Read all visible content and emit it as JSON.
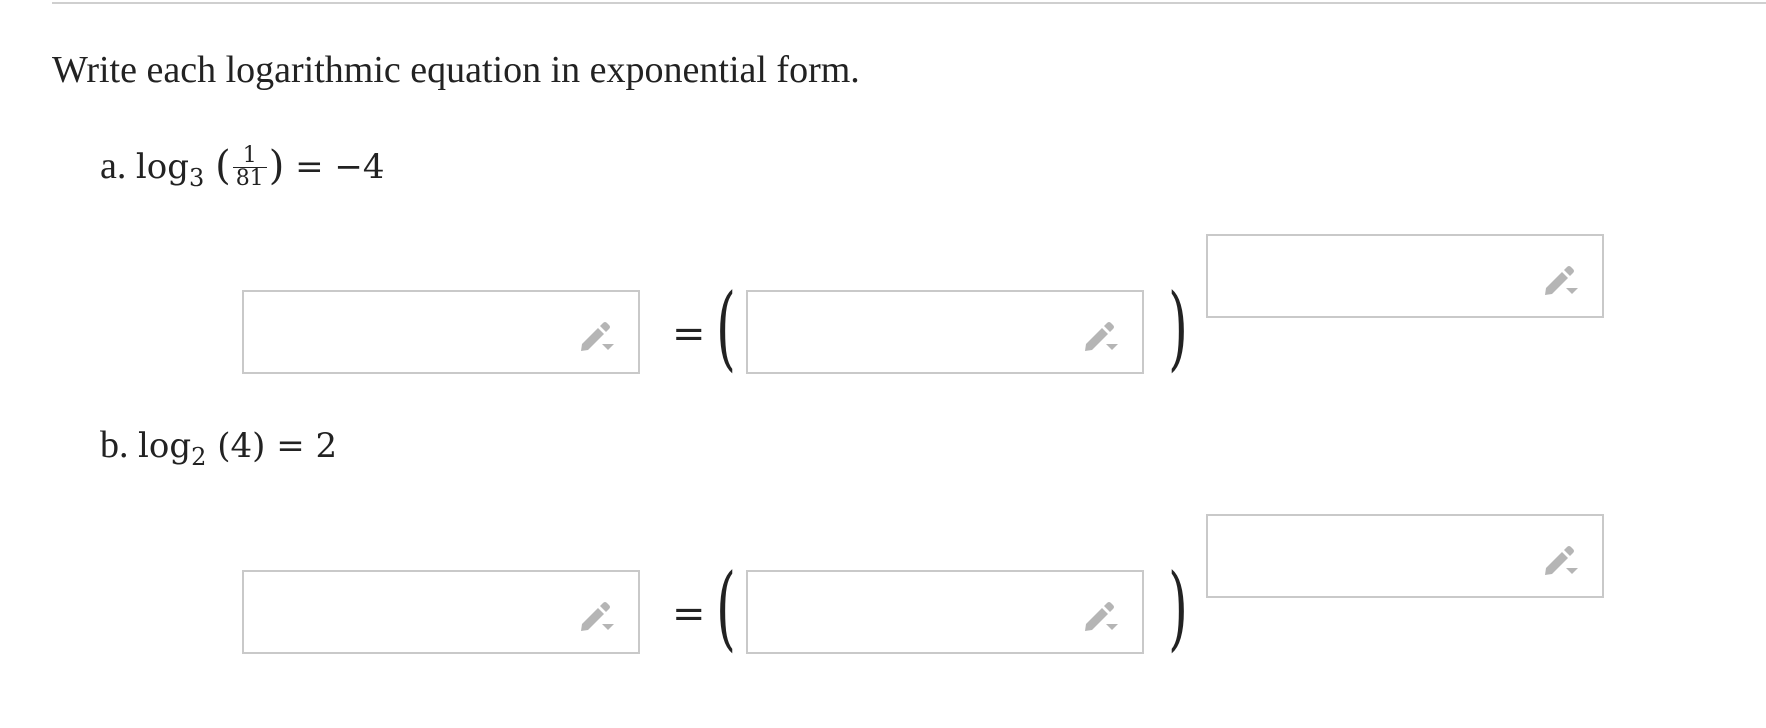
{
  "instruction": "Write each logarithmic equation in exponential form.",
  "problems": [
    {
      "label": "a.",
      "log_word": "log",
      "base": "3",
      "open_paren": "(",
      "argument_numerator": "1",
      "argument_denominator": "81",
      "close_paren": ")",
      "equals": "=",
      "result": "−4",
      "answer": {
        "lhs_value": "",
        "base_value": "",
        "exponent_value": "",
        "equals": "=",
        "open_paren": "(",
        "close_paren": ")"
      }
    },
    {
      "label": "b.",
      "log_word": "log",
      "base": "2",
      "argument": "(4)",
      "equals": "=",
      "result": "2",
      "answer": {
        "lhs_value": "",
        "base_value": "",
        "exponent_value": "",
        "equals": "=",
        "open_paren": "(",
        "close_paren": ")"
      }
    }
  ],
  "icons": {
    "edit": "pencil-dropdown-icon",
    "icon_color": "#b5b5b5"
  },
  "colors": {
    "box_border": "#c9c9c9",
    "text": "#222222",
    "rule": "#cfcfcf"
  }
}
